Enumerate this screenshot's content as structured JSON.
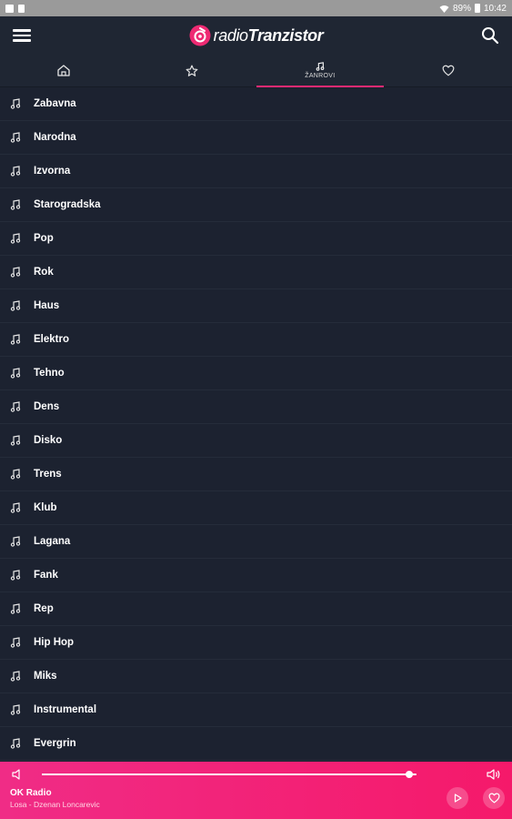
{
  "status_bar": {
    "battery": "89%",
    "time": "10:42"
  },
  "app": {
    "title_light": "radio",
    "title_bold": "Tranzistor"
  },
  "tabs": [
    {
      "icon": "home-icon",
      "label": ""
    },
    {
      "icon": "star-icon",
      "label": ""
    },
    {
      "icon": "music-note-icon",
      "label": "ŽANROVI"
    },
    {
      "icon": "heart-icon",
      "label": ""
    }
  ],
  "genres": [
    "Zabavna",
    "Narodna",
    "Izvorna",
    "Starogradska",
    "Pop",
    "Rok",
    "Haus",
    "Elektro",
    "Tehno",
    "Dens",
    "Disko",
    "Trens",
    "Klub",
    "Lagana",
    "Fank",
    "Rep",
    "Hip Hop",
    "Miks",
    "Instrumental",
    "Evergrin"
  ],
  "player": {
    "station": "OK Radio",
    "track": "Losa - Dzenan Loncarevic",
    "volume": 0.98
  },
  "colors": {
    "accent": "#ee2a73",
    "background": "#1c2230",
    "bar": "#1f2633"
  }
}
